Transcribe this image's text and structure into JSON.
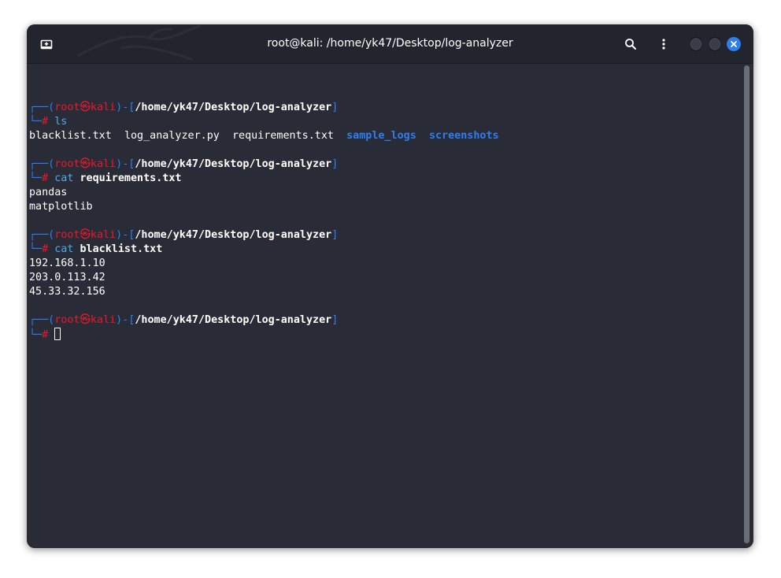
{
  "window": {
    "title": "root@kali: /home/yk47/Desktop/log-analyzer"
  },
  "titlebar": {
    "new_tab_icon": "new-tab-icon",
    "search_icon": "search-icon",
    "menu_icon": "kebab-menu-icon",
    "close_icon": "close-icon"
  },
  "colors": {
    "prompt_frame": "#2f7ef0",
    "user_host": "#e8182b",
    "directory_listing": "#2f7ef0",
    "command": "#4fa8e8",
    "background": "#292c37",
    "titlebar": "#23252e"
  },
  "prompt": {
    "open_corner": "┌──(",
    "user": "root",
    "at": "㉿",
    "host": "kali",
    "mid": ")-[",
    "path": "/home/yk47/Desktop/log-analyzer",
    "close": "]",
    "lower_corner": "└─",
    "symbol": "#"
  },
  "blocks": [
    {
      "command": "ls",
      "args": "",
      "listing": {
        "file1": "blacklist.txt",
        "file2": "log_analyzer.py",
        "file3": "requirements.txt",
        "dir1": "sample_logs",
        "dir2": "screenshots"
      }
    },
    {
      "command": "cat",
      "args": "requirements.txt",
      "output": [
        "pandas",
        "matplotlib"
      ]
    },
    {
      "command": "cat",
      "args": "blacklist.txt",
      "output": [
        "192.168.1.10",
        "203.0.113.42",
        "45.33.32.156"
      ]
    }
  ]
}
